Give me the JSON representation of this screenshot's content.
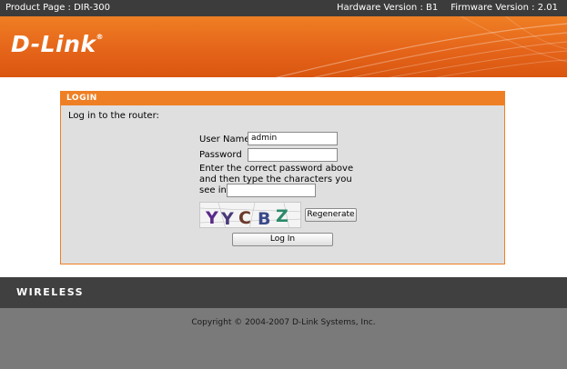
{
  "topbar": {
    "product_page": "Product Page :  DIR-300",
    "hardware_version": "Hardware Version : B1",
    "firmware_version": "Firmware Version : 2.01"
  },
  "header": {
    "logo_text": "D-Link",
    "brand_color": "#e5651a"
  },
  "login": {
    "title": "LOGIN",
    "intro": "Log in to the router:",
    "username_label": "User Name",
    "username_value": "admin",
    "password_label": "Password",
    "password_value": "",
    "instructions": "Enter the correct password above and then type the characters you see in the picture below.",
    "captcha_input_value": "",
    "captcha_text": "YYCBZ",
    "regenerate_label": "Regenerate",
    "login_button_label": "Log In"
  },
  "wireless_bar": {
    "label": "WIRELESS"
  },
  "footer": {
    "copyright": "Copyright © 2004-2007 D-Link Systems, Inc."
  }
}
